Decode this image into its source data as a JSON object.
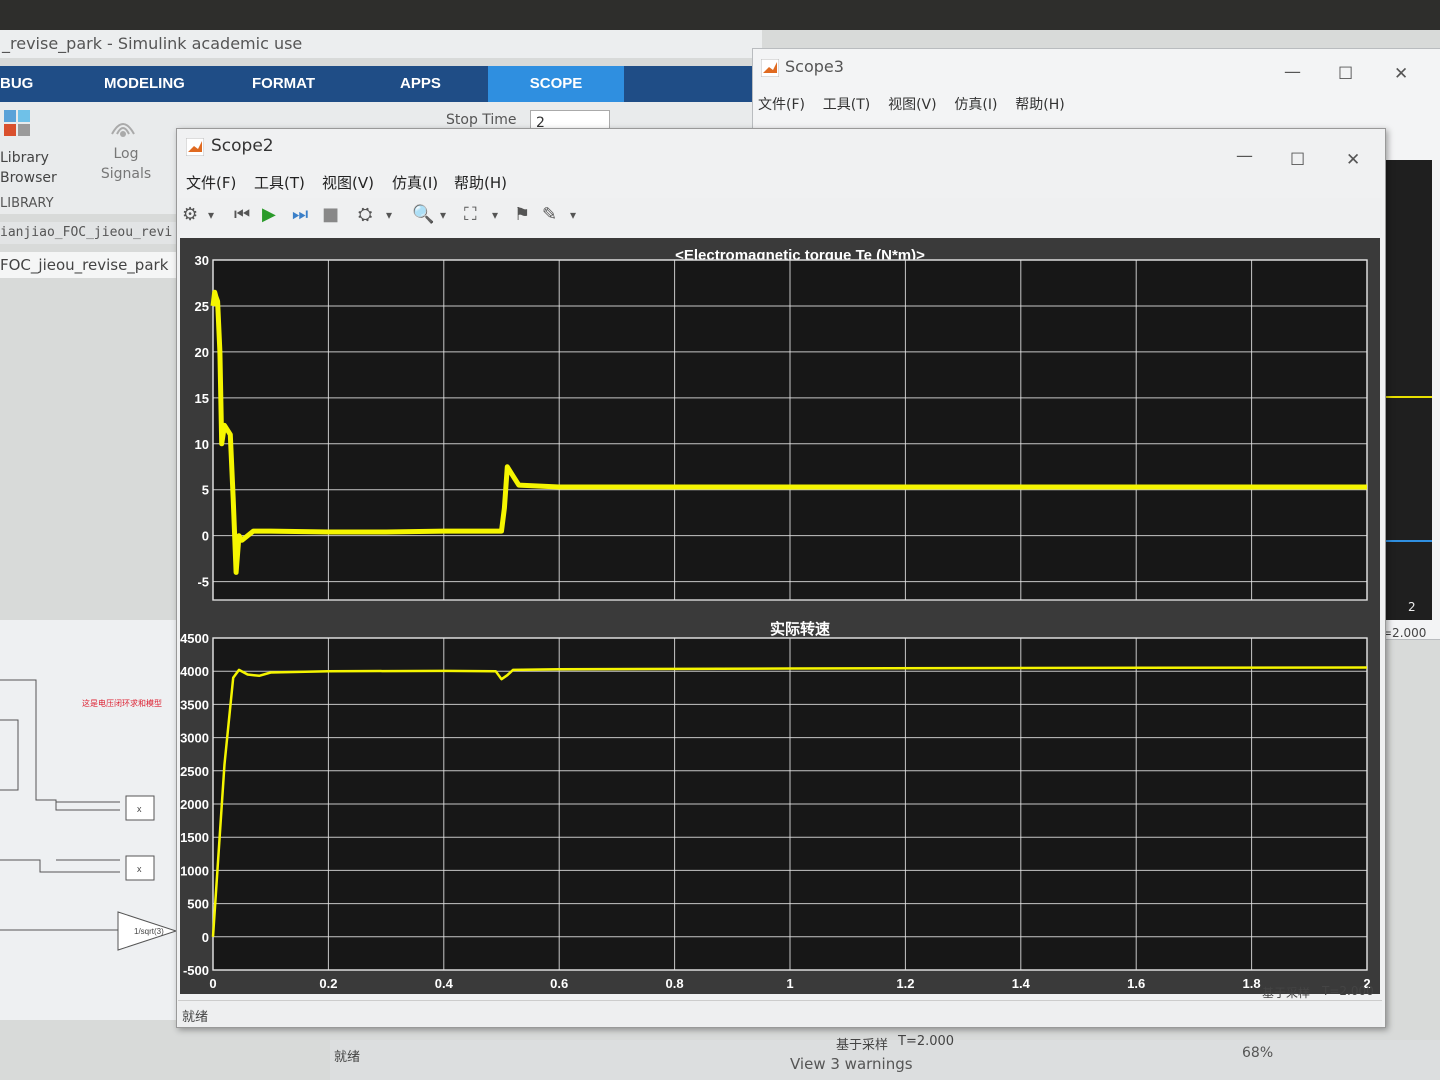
{
  "simulink": {
    "window_title": "_revise_park - Simulink academic use",
    "tabs": [
      "BUG",
      "MODELING",
      "FORMAT",
      "APPS",
      "SCOPE"
    ],
    "active_tab": "SCOPE",
    "library_browser": "Library Browser",
    "library_label": "LIBRARY",
    "log_signals": "Log Signals",
    "stop_time_label": "Stop Time",
    "stop_time_value": "2",
    "path_tab": "ianjiao_FOC_jieou_revi",
    "model_name": "FOC_jieou_revise_park",
    "block_label": "1/sqrt(3)",
    "red_note": "这是电压闭环求和模型",
    "status_ready": "就绪",
    "status_mode": "基于采样",
    "status_time": "T=2.000",
    "warnings": "View 3 warnings",
    "zoom": "68%"
  },
  "scope3": {
    "title": "Scope3",
    "menu": [
      "文件(F)",
      "工具(T)",
      "视图(V)",
      "仿真(I)",
      "帮助(H)"
    ],
    "x_end_tick": "2",
    "status_time": "=2.000"
  },
  "scope2": {
    "title": "Scope2",
    "menu": [
      "文件(F)",
      "工具(T)",
      "视图(V)",
      "仿真(I)",
      "帮助(H)"
    ],
    "status_ready": "就绪",
    "status_mode": "基于采样",
    "status_time": "T=2.000",
    "trace_color": "#f5f500",
    "background_color": "#171717",
    "grid_color": "#e6e6e6"
  },
  "chart_data": [
    {
      "type": "line",
      "title": "<Electromagnetic torque Te (N*m)>",
      "xlim": [
        0,
        2
      ],
      "ylim": [
        -7,
        30
      ],
      "yticks": [
        30,
        25,
        20,
        15,
        10,
        5,
        0,
        -5
      ],
      "x_gridlines": [
        0,
        0.2,
        0.4,
        0.6,
        0.8,
        1,
        1.2,
        1.4,
        1.6,
        1.8,
        2
      ],
      "grid": true,
      "series": [
        {
          "x": [
            0,
            0.003,
            0.005,
            0.008,
            0.012,
            0.015,
            0.02,
            0.03,
            0.035,
            0.04,
            0.045,
            0.05,
            0.07,
            0.1,
            0.2,
            0.3,
            0.4,
            0.5,
            0.505,
            0.51,
            0.52,
            0.53,
            0.6,
            0.8,
            1.0,
            1.2,
            1.4,
            1.6,
            1.8,
            2.0
          ],
          "y": [
            25,
            26.5,
            26,
            25.5,
            20,
            10,
            12,
            11,
            4,
            -4,
            0,
            -0.5,
            0.5,
            0.5,
            0.4,
            0.4,
            0.5,
            0.5,
            3,
            7.5,
            6.5,
            5.5,
            5.3,
            5.3,
            5.3,
            5.3,
            5.3,
            5.3,
            5.3,
            5.3
          ]
        }
      ]
    },
    {
      "type": "line",
      "title": "实际转速",
      "xlim": [
        0,
        2
      ],
      "ylim": [
        -500,
        4500
      ],
      "yticks": [
        4500,
        4000,
        3500,
        3000,
        2500,
        2000,
        1500,
        1000,
        500,
        0,
        -500
      ],
      "xticks": [
        "0",
        "0.2",
        "0.4",
        "0.6",
        "0.8",
        "1",
        "1.2",
        "1.4",
        "1.6",
        "1.8",
        "2"
      ],
      "grid": true,
      "series": [
        {
          "x": [
            0,
            0.02,
            0.035,
            0.045,
            0.06,
            0.08,
            0.1,
            0.2,
            0.4,
            0.49,
            0.5,
            0.51,
            0.52,
            0.6,
            1.0,
            1.5,
            2.0
          ],
          "y": [
            0,
            2600,
            3900,
            4020,
            3950,
            3930,
            3980,
            4000,
            4005,
            4000,
            3880,
            3940,
            4020,
            4030,
            4040,
            4050,
            4055
          ]
        }
      ]
    }
  ]
}
